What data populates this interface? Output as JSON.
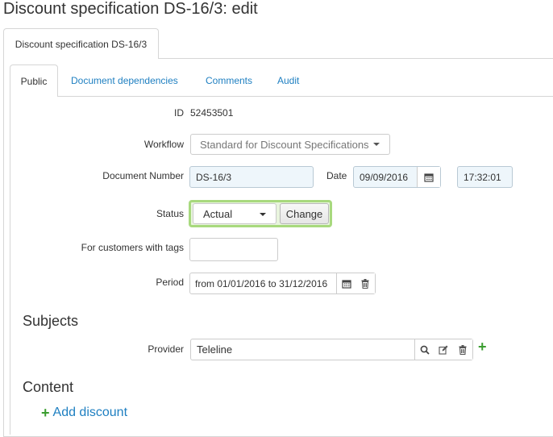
{
  "page": {
    "title": "Discount specification DS-16/3: edit"
  },
  "outer_tab": {
    "label": "Discount specification DS-16/3"
  },
  "tabs": [
    {
      "label": "Public",
      "active": true
    },
    {
      "label": "Document dependencies",
      "active": false
    },
    {
      "label": "Comments",
      "active": false
    },
    {
      "label": "Audit",
      "active": false
    }
  ],
  "form": {
    "id": {
      "label": "ID",
      "value": "52453501"
    },
    "workflow": {
      "label": "Workflow",
      "value": "Standard for Discount Specifications"
    },
    "document_number": {
      "label": "Document Number",
      "value": "DS-16/3"
    },
    "date": {
      "label": "Date",
      "value": "09/09/2016",
      "time": "17:32:01"
    },
    "status": {
      "label": "Status",
      "value": "Actual",
      "button": "Change"
    },
    "customer_tags": {
      "label": "For customers with tags",
      "value": ""
    },
    "period": {
      "label": "Period",
      "value": "from 01/01/2016 to 31/12/2016"
    }
  },
  "subjects": {
    "title": "Subjects",
    "provider": {
      "label": "Provider",
      "value": "Teleline"
    }
  },
  "content": {
    "title": "Content",
    "add_discount": "Add discount"
  },
  "colors": {
    "link": "#1e7fc1",
    "status_highlight": "#a8d97e",
    "add_green": "#3a9d2f",
    "tinted_input": "#eef6fb"
  }
}
